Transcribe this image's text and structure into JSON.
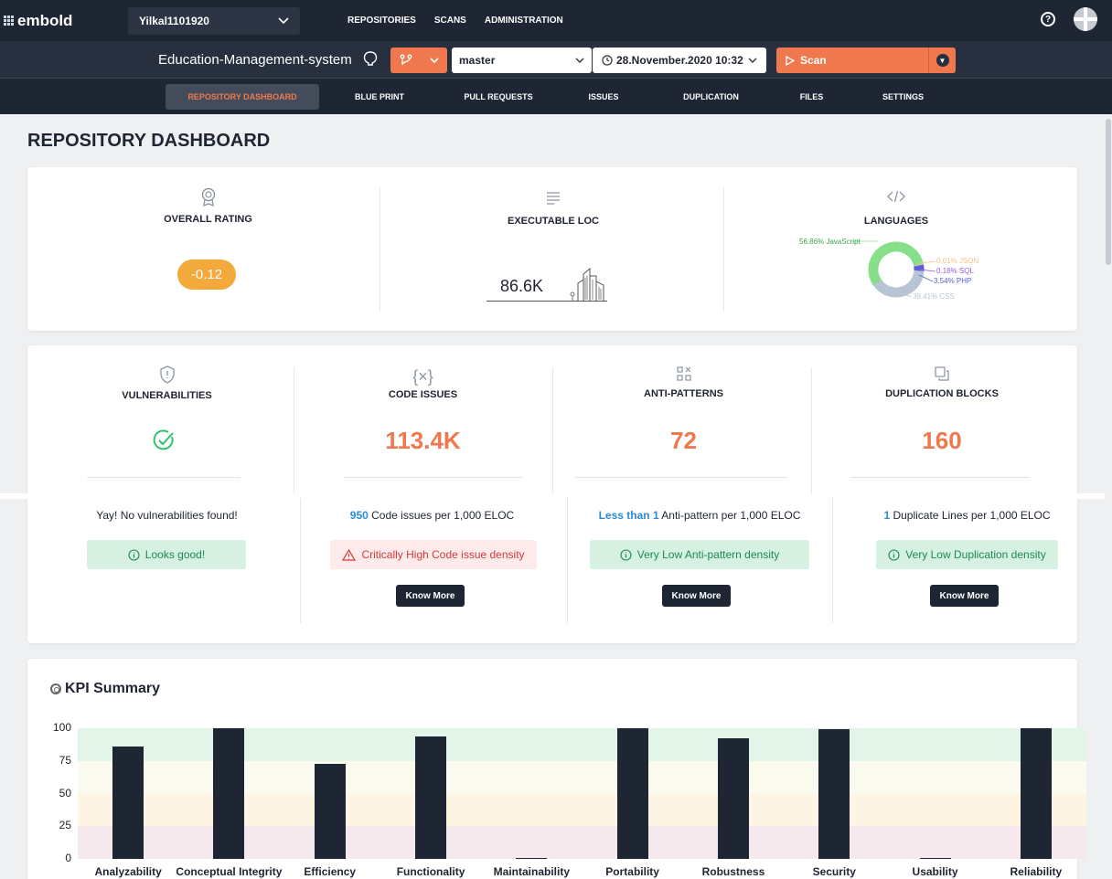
{
  "app": {
    "brand": "embold",
    "org": "Yilkal1101920"
  },
  "topnav": [
    "REPOSITORIES",
    "SCANS",
    "ADMINISTRATION"
  ],
  "repo": {
    "name": "Education-Management-system",
    "branch": "master",
    "date": "28.November.2020 10:32",
    "scan_label": "Scan"
  },
  "tabs": [
    "REPOSITORY DASHBOARD",
    "BLUE PRINT",
    "PULL REQUESTS",
    "ISSUES",
    "DUPLICATION",
    "FILES",
    "SETTINGS"
  ],
  "page_title": "REPOSITORY DASHBOARD",
  "overview": {
    "overall_rating": {
      "title": "OVERALL RATING",
      "value": "-0.12",
      "color": "#f3a93b"
    },
    "loc": {
      "title": "EXECUTABLE LOC",
      "value": "86.6K"
    },
    "languages": {
      "title": "LANGUAGES",
      "items": [
        {
          "label": "56.86% JavaScript",
          "pct": 56.86,
          "color": "#86e08a"
        },
        {
          "label": "0.01% JSON",
          "pct": 0.01,
          "color": "#f5c08a"
        },
        {
          "label": "0.18% SQL",
          "pct": 0.18,
          "color": "#9b5de5"
        },
        {
          "label": "3.54% PHP",
          "pct": 3.54,
          "color": "#5b5fd6"
        },
        {
          "label": "39.41% CSS",
          "pct": 39.41,
          "color": "#b7c4d4"
        }
      ]
    }
  },
  "stats": [
    {
      "title": "VULNERABILITIES",
      "value": "",
      "density_prefix": "",
      "density_text": "Yay! No vulnerabilities found!",
      "badge": "Looks good!",
      "badge_type": "good",
      "know_more": ""
    },
    {
      "title": "CODE ISSUES",
      "value": "113.4K",
      "density_prefix": "950",
      "density_text": " Code issues per 1,000 ELOC",
      "badge": "Critically High Code issue density",
      "badge_type": "bad",
      "know_more": "Know More"
    },
    {
      "title": "ANTI-PATTERNS",
      "value": "72",
      "density_prefix": "Less than 1",
      "density_text": " Anti-pattern per 1,000 ELOC",
      "badge": "Very Low Anti-pattern density",
      "badge_type": "good",
      "know_more": "Know More"
    },
    {
      "title": "DUPLICATION BLOCKS",
      "value": "160",
      "density_prefix": "1",
      "density_text": " Duplicate Lines per 1,000 ELOC",
      "badge": "Very Low Duplication density",
      "badge_type": "good",
      "know_more": "Know More"
    }
  ],
  "kpi": {
    "title": "KPI Summary"
  },
  "chart_data": {
    "type": "bar",
    "title": "KPI Summary",
    "categories": [
      "Analyzability",
      "Conceptual Integrity",
      "Efficiency",
      "Functionality",
      "Maintainability",
      "Portability",
      "Robustness",
      "Security",
      "Usability",
      "Reliability"
    ],
    "values": [
      86,
      100,
      73,
      94,
      1,
      100,
      92,
      99,
      1,
      100
    ],
    "ylim": [
      0,
      100
    ],
    "yticks": [
      0,
      25,
      50,
      75,
      100
    ],
    "bands": [
      {
        "from": 75,
        "to": 100,
        "color": "#e3f5e8"
      },
      {
        "from": 50,
        "to": 75,
        "color": "#fbfaef"
      },
      {
        "from": 25,
        "to": 50,
        "color": "#fef4e4"
      },
      {
        "from": 0,
        "to": 25,
        "color": "#f6e9ee"
      }
    ],
    "bar_color": "#1e2533"
  }
}
